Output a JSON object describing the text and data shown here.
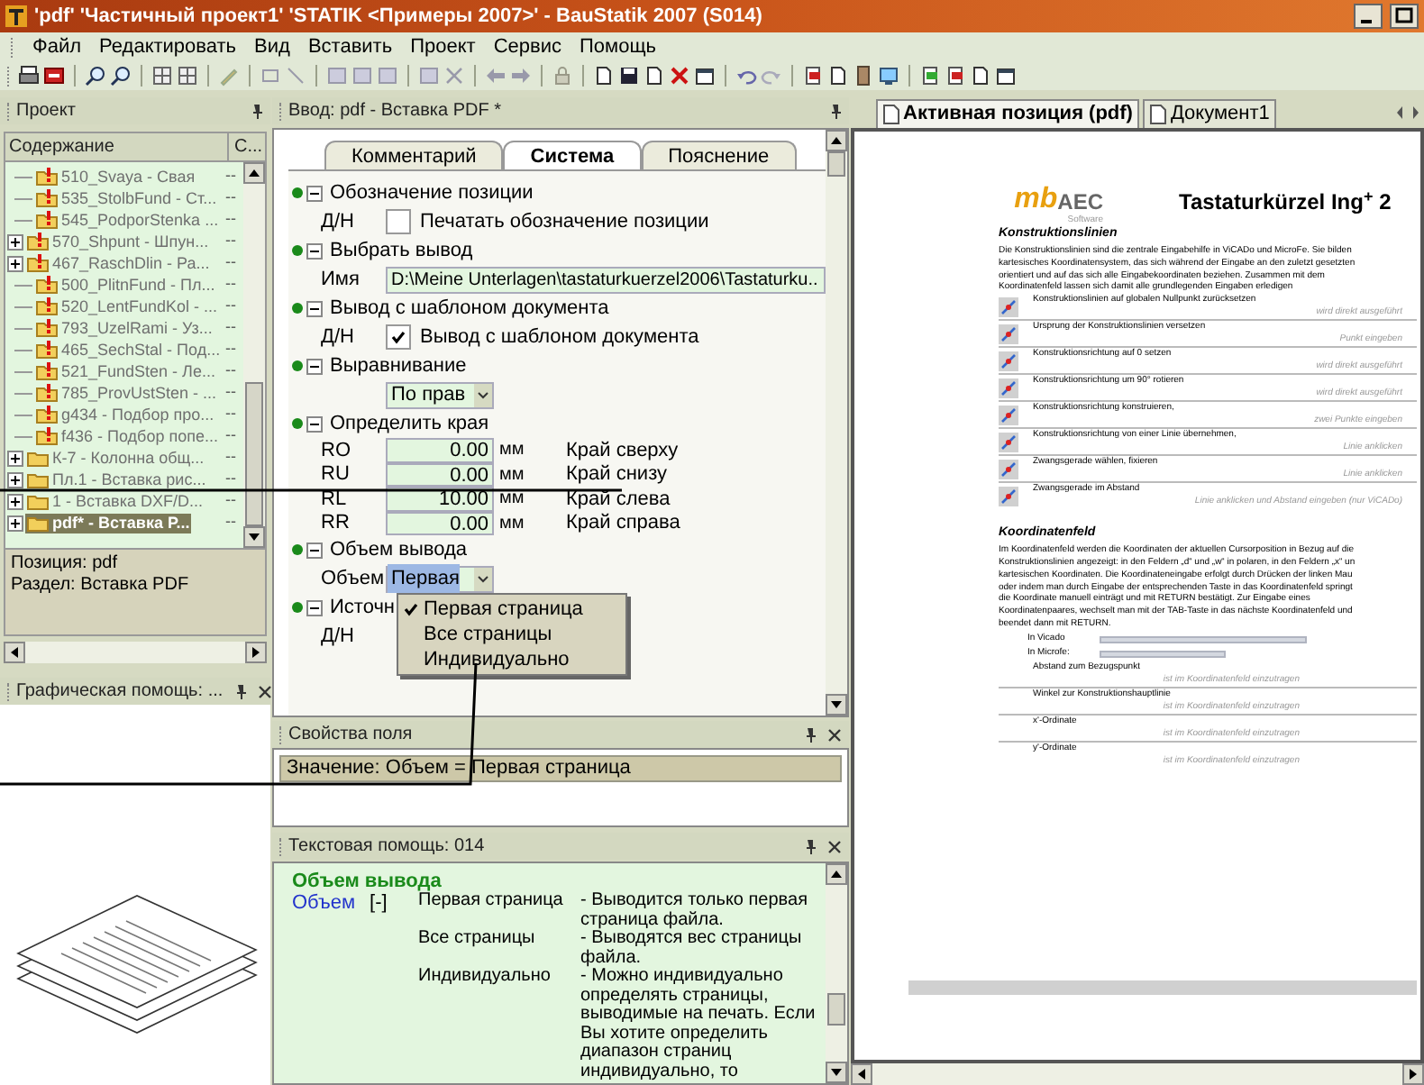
{
  "window": {
    "title": "'pdf' 'Частичный проект1' 'STATIK <Примеры 2007>' - BauStatik 2007 (S014)"
  },
  "menu": [
    "Файл",
    "Редактировать",
    "Вид",
    "Вставить",
    "Проект",
    "Сервис",
    "Помощь"
  ],
  "project_panel": {
    "title": "Проект",
    "columns": [
      "Содержание",
      "С..."
    ],
    "items": [
      {
        "label": "510_Svaya - Свая",
        "column_2": "--",
        "expandable": false,
        "flagged": true,
        "selected": false
      },
      {
        "label": "535_StolbFund - Ст...",
        "column_2": "--",
        "expandable": false,
        "flagged": true,
        "selected": false
      },
      {
        "label": "545_PodporStenka ...",
        "column_2": "--",
        "expandable": false,
        "flagged": true,
        "selected": false
      },
      {
        "label": "570_Shpunt - Шпун...",
        "column_2": "--",
        "expandable": true,
        "flagged": true,
        "selected": false
      },
      {
        "label": "467_RaschDlin - Ра...",
        "column_2": "--",
        "expandable": true,
        "flagged": true,
        "selected": false
      },
      {
        "label": "500_PlitnFund - Пл...",
        "column_2": "--",
        "expandable": false,
        "flagged": true,
        "selected": false
      },
      {
        "label": "520_LentFundKol - ...",
        "column_2": "--",
        "expandable": false,
        "flagged": true,
        "selected": false
      },
      {
        "label": "793_UzelRami - Уз...",
        "column_2": "--",
        "expandable": false,
        "flagged": true,
        "selected": false
      },
      {
        "label": "465_SechStal - Под...",
        "column_2": "--",
        "expandable": false,
        "flagged": true,
        "selected": false
      },
      {
        "label": "521_FundSten - Ле...",
        "column_2": "--",
        "expandable": false,
        "flagged": true,
        "selected": false
      },
      {
        "label": "785_ProvUstSten - ...",
        "column_2": "--",
        "expandable": false,
        "flagged": true,
        "selected": false
      },
      {
        "label": "g434 - Подбор про...",
        "column_2": "--",
        "expandable": false,
        "flagged": true,
        "selected": false
      },
      {
        "label": "f436 - Подбор попе...",
        "column_2": "--",
        "expandable": false,
        "flagged": true,
        "selected": false
      },
      {
        "label": "К-7 - Колонна общ...",
        "column_2": "--",
        "expandable": true,
        "flagged": false,
        "selected": false
      },
      {
        "label": "Пл.1 - Вставка рис...",
        "column_2": "--",
        "expandable": true,
        "flagged": false,
        "selected": false
      },
      {
        "label": "1 - Вставка DXF/D...",
        "column_2": "--",
        "expandable": true,
        "flagged": false,
        "selected": false
      },
      {
        "label": "pdf* - Вставка P...",
        "column_2": "--",
        "expandable": true,
        "flagged": false,
        "selected": true
      }
    ],
    "info": [
      "Позиция: pdf",
      "Раздел: Вставка PDF"
    ]
  },
  "graphic_help_panel": {
    "title": "Графическая помощь: ..."
  },
  "input_panel": {
    "title": "Ввод: pdf - Вставка PDF *",
    "tabs": [
      {
        "label": "Комментарий",
        "selected": false
      },
      {
        "label": "Система",
        "selected": true
      },
      {
        "label": "Пояснение",
        "selected": false
      }
    ],
    "sections": [
      {
        "title": "Обозначение позиции",
        "expanded": true,
        "rows": [
          {
            "kind": "checkbox",
            "label": "Д/Н",
            "checked": false,
            "text": "Печатать обозначение позиции"
          }
        ]
      },
      {
        "title": "Выбрать вывод",
        "expanded": true,
        "rows": [
          {
            "kind": "text",
            "label": "Имя",
            "value": "D:\\Meine Unterlagen\\tastaturkuerzel2006\\Tastaturku.."
          }
        ]
      },
      {
        "title": "Вывод с шаблоном документа",
        "expanded": true,
        "rows": [
          {
            "kind": "checkbox",
            "label": "Д/Н",
            "checked": true,
            "text": "Вывод с шаблоном документа"
          }
        ]
      },
      {
        "title": "Выравнивание",
        "expanded": true,
        "rows": [
          {
            "kind": "dropdown",
            "value": "По прав",
            "highlighted": false
          }
        ]
      },
      {
        "title": "Определить края",
        "expanded": true,
        "rows": [
          {
            "kind": "measure",
            "label": "RO",
            "value": "0.00",
            "unit": "мм",
            "text": "Край сверху"
          },
          {
            "kind": "measure",
            "label": "RU",
            "value": "0.00",
            "unit": "мм",
            "text": "Край снизу"
          },
          {
            "kind": "measure",
            "label": "RL",
            "value": "10.00",
            "unit": "мм",
            "text": "Край слева"
          },
          {
            "kind": "measure",
            "label": "RR",
            "value": "0.00",
            "unit": "мм",
            "text": "Край справа"
          }
        ]
      },
      {
        "title": "Объем вывода",
        "expanded": true,
        "rows": [
          {
            "kind": "dropdown",
            "label": "Объем",
            "value": "Первая",
            "highlighted": true
          }
        ]
      },
      {
        "title": "Источн",
        "expanded": true,
        "rows": [
          {
            "kind": "covered",
            "label": "Д/Н"
          }
        ]
      }
    ]
  },
  "dropdown_menu": {
    "items": [
      {
        "label": "Первая страница",
        "checked": true
      },
      {
        "label": "Все страницы",
        "checked": false
      },
      {
        "label": "Индивидуально",
        "checked": false
      }
    ]
  },
  "field_properties": {
    "title": "Свойства поля",
    "value": "Значение: Объем = Первая страница"
  },
  "text_help": {
    "title": "Текстовая помощь: 014",
    "heading": "Объем вывода",
    "field": "Объем",
    "field_note": "[-]",
    "entries": [
      {
        "term": "Первая страница",
        "description": "- Выводится только первая страница файла."
      },
      {
        "term": "Все страницы",
        "description": "- Выводятся вес страницы файла."
      },
      {
        "term": "Индивидуально",
        "description": "- Можно индивидуально определять страницы, выводимые на печать. Если Вы хотите определить диапазон страниц индивидуально, то"
      }
    ]
  },
  "document_tabs": [
    {
      "label": "Активная позиция (pdf)",
      "selected": true
    },
    {
      "label": "Документ1",
      "selected": false
    }
  ],
  "document": {
    "logo_mark": "mb",
    "logo_text": "AEC",
    "logo_sub": "Software",
    "title": "Tastaturkürzel Ing$^{+}$ 2",
    "sections": [
      {
        "heading": "Konstruktionslinien",
        "lines": [
          "Die Konstruktionslinien sind die zentrale Eingabehilfe in ViCADo und MicroFe. Sie bilden",
          "kartesisches Koordinatensystem, das sich während der Eingabe an den zuletzt gesetzten",
          "orientiert und auf das sich alle Eingabekoordinaten beziehen. Zusammen mit dem",
          "Koordinatenfeld lassen sich damit alle grundlegenden Eingaben erledigen"
        ],
        "rows": [
          {
            "kind": "icon",
            "text": "Konstruktionslinien auf globalen Nullpunkt zurücksetzen",
            "hint": "wird direkt ausgeführt"
          },
          {
            "kind": "icon",
            "text": "Ursprung der Konstruktionslinien versetzen",
            "hint": "Punkt eingeben"
          },
          {
            "kind": "icon",
            "text": "Konstruktionsrichtung auf 0 setzen",
            "hint": "wird direkt ausgeführt"
          },
          {
            "kind": "icon",
            "text": "Konstruktionsrichtung um 90° rotieren",
            "hint": "wird direkt ausgeführt"
          },
          {
            "kind": "icon",
            "text": "Konstruktionsrichtung konstruieren,",
            "hint": "zwei Punkte eingeben"
          },
          {
            "kind": "icon",
            "text": "Konstruktionsrichtung von einer Linie übernehmen,",
            "hint": "Linie anklicken"
          },
          {
            "kind": "icon",
            "text": "Zwangsgerade wählen, fixieren",
            "hint": "Linie anklicken"
          },
          {
            "kind": "icon",
            "text": "Zwangsgerade im Abstand",
            "hint": "Linie anklicken und Abstand eingeben (nur ViCADo)"
          }
        ]
      },
      {
        "heading": "Koordinatenfeld",
        "lines": [
          "Im Koordinatenfeld werden die Koordinaten der aktuellen Cursorposition in Bezug auf die",
          "Konstruktionslinien angezeigt: in den Feldern „d“ und „w“ in polaren, in den Feldern „x“ un",
          "kartesischen Koordinaten. Die Koordinateneingabe erfolgt durch Drücken der linken Mau",
          "oder indem man durch Eingabe der entsprechenden Taste in das Koordinatenfeld springt",
          "die Koordinate manuell einträgt und mit RETURN bestätigt. Zur Eingabe eines",
          "Koordinatenpaares, wechselt man mit der TAB-Taste in das nächste Koordinatenfeld und",
          "beendet dann mit RETURN."
        ],
        "inputs": [
          "In Vicado",
          "In Microfe:"
        ],
        "rows": [
          {
            "kind": "plain",
            "text": "Abstand zum Bezugspunkt",
            "hint": "ist im Koordinatenfeld einzutragen"
          },
          {
            "kind": "plain",
            "text": "Winkel zur Konstruktionshauptlinie",
            "hint": "ist im Koordinatenfeld einzutragen"
          },
          {
            "kind": "plain",
            "text": "x'-Ordinate",
            "hint": "ist im Koordinatenfeld einzutragen"
          },
          {
            "kind": "plain",
            "text": "y'-Ordinate",
            "hint": "ist im Koordinatenfeld einzutragen"
          }
        ]
      }
    ]
  }
}
